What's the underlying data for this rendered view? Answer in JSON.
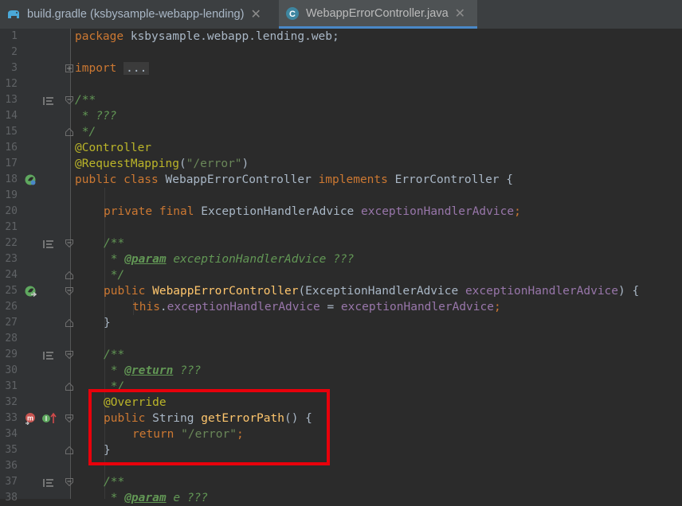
{
  "tabs": [
    {
      "label": "build.gradle (ksbysample-webapp-lending)",
      "icon": "gradle-elephant-icon"
    },
    {
      "label": "WebappErrorController.java",
      "icon": "class-c-icon",
      "icon_letter": "C",
      "active": true
    }
  ],
  "lines": [
    {
      "n": "1",
      "code": "package ksbysample.webapp.lending.web;"
    },
    {
      "n": "2",
      "code": ""
    },
    {
      "n": "3",
      "code": "import ..."
    },
    {
      "n": "12",
      "code": ""
    },
    {
      "n": "13",
      "code": "/**"
    },
    {
      "n": "14",
      "code": " * ???"
    },
    {
      "n": "15",
      "code": " */"
    },
    {
      "n": "16",
      "code": "@Controller"
    },
    {
      "n": "17",
      "code": "@RequestMapping(\"/error\")"
    },
    {
      "n": "18",
      "code": "public class WebappErrorController implements ErrorController {"
    },
    {
      "n": "19",
      "code": ""
    },
    {
      "n": "20",
      "code": "private final ExceptionHandlerAdvice exceptionHandlerAdvice;"
    },
    {
      "n": "21",
      "code": ""
    },
    {
      "n": "22",
      "code": "/**"
    },
    {
      "n": "23",
      "code": " * @param exceptionHandlerAdvice ???"
    },
    {
      "n": "24",
      "code": " */"
    },
    {
      "n": "25",
      "code": "public WebappErrorController(ExceptionHandlerAdvice exceptionHandlerAdvice) {"
    },
    {
      "n": "26",
      "code": "this.exceptionHandlerAdvice = exceptionHandlerAdvice;"
    },
    {
      "n": "27",
      "code": "}"
    },
    {
      "n": "28",
      "code": ""
    },
    {
      "n": "29",
      "code": "/**"
    },
    {
      "n": "30",
      "code": " * @return ???"
    },
    {
      "n": "31",
      "code": " */"
    },
    {
      "n": "32",
      "code": "@Override"
    },
    {
      "n": "33",
      "code": "public String getErrorPath() {"
    },
    {
      "n": "34",
      "code": "return \"/error\";"
    },
    {
      "n": "35",
      "code": "}"
    },
    {
      "n": "36",
      "code": ""
    },
    {
      "n": "37",
      "code": "/**"
    },
    {
      "n": "38",
      "code": " * @param e ???"
    }
  ],
  "colors": {
    "keyword": "#cc7832",
    "annotation": "#bbb529",
    "string": "#6a8759",
    "field": "#9876aa",
    "comment": "#629755",
    "method": "#ffc66d",
    "highlight_border": "#e8000b"
  }
}
